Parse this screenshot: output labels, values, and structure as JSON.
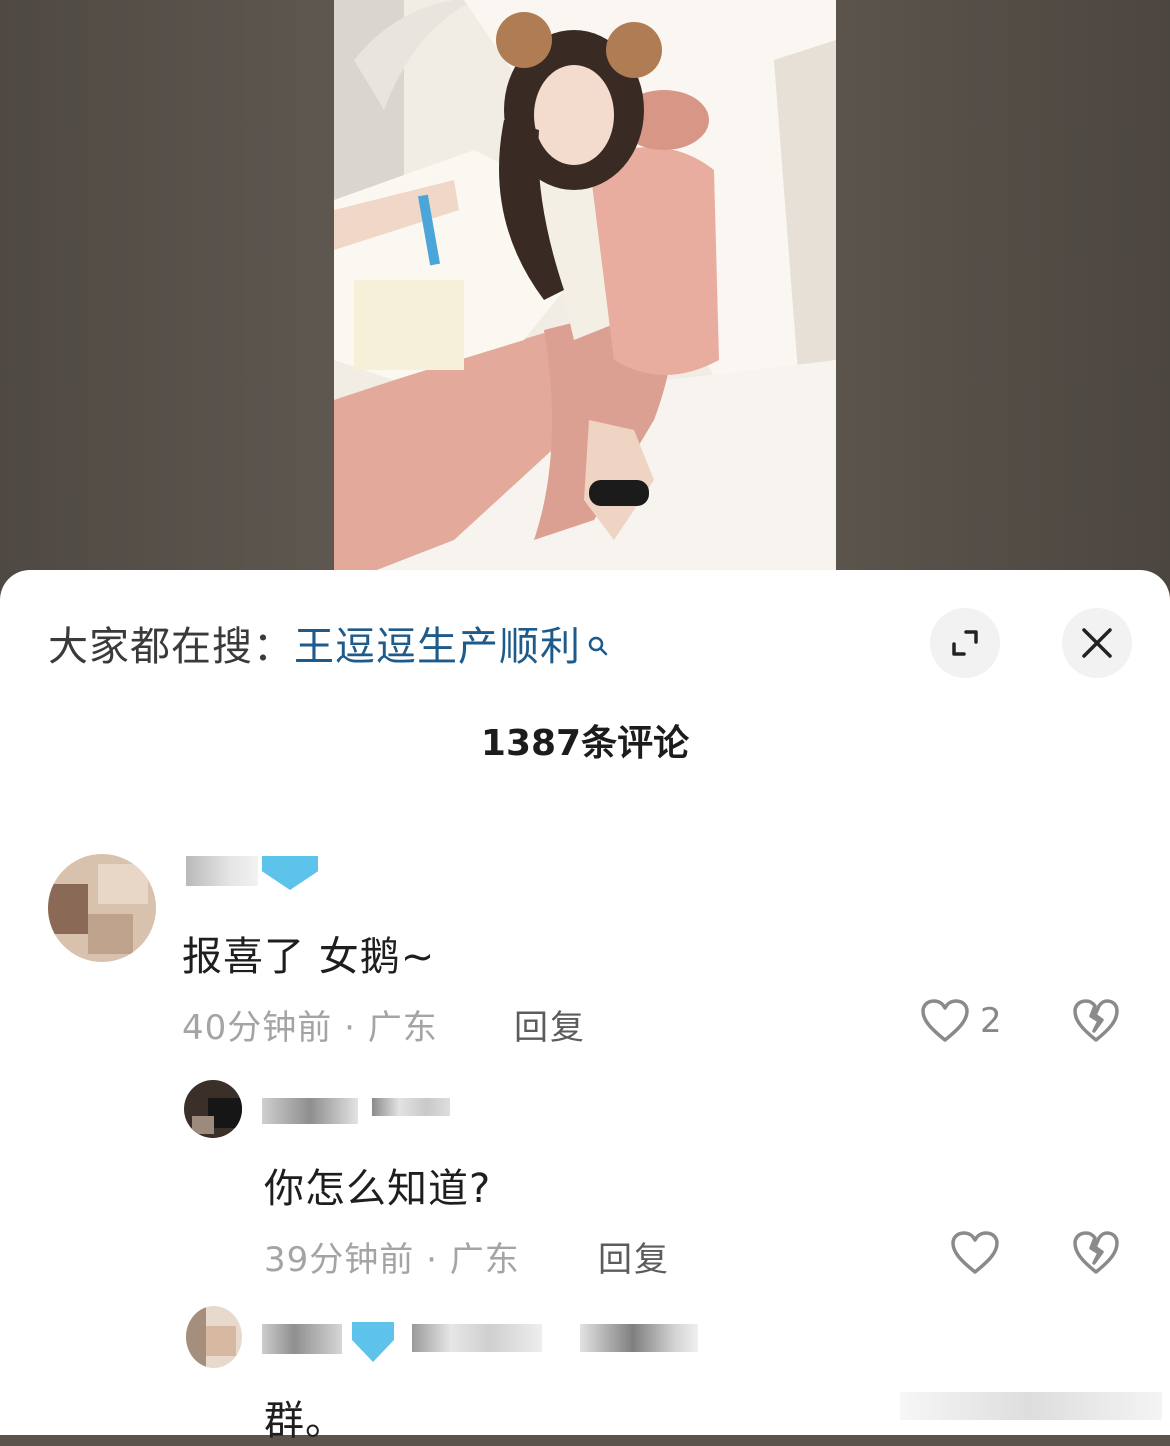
{
  "search_banner": {
    "prefix": "大家都在搜：",
    "term": "王逗逗生产顺利"
  },
  "comment_count": "1387条评论",
  "comments": [
    {
      "text": "报喜了 女鹅~",
      "time": "40分钟前",
      "location": "广东",
      "reply_label": "回复",
      "likes": "2"
    }
  ],
  "replies": [
    {
      "text": "你怎么知道?",
      "time": "39分钟前",
      "location": "广东",
      "reply_label": "回复"
    },
    {
      "text": "群。"
    }
  ],
  "separator": "·",
  "colors": {
    "search_term": "#1e5a8a",
    "meta_text": "#a4a4a4",
    "sheet_bg": "#ffffff"
  }
}
